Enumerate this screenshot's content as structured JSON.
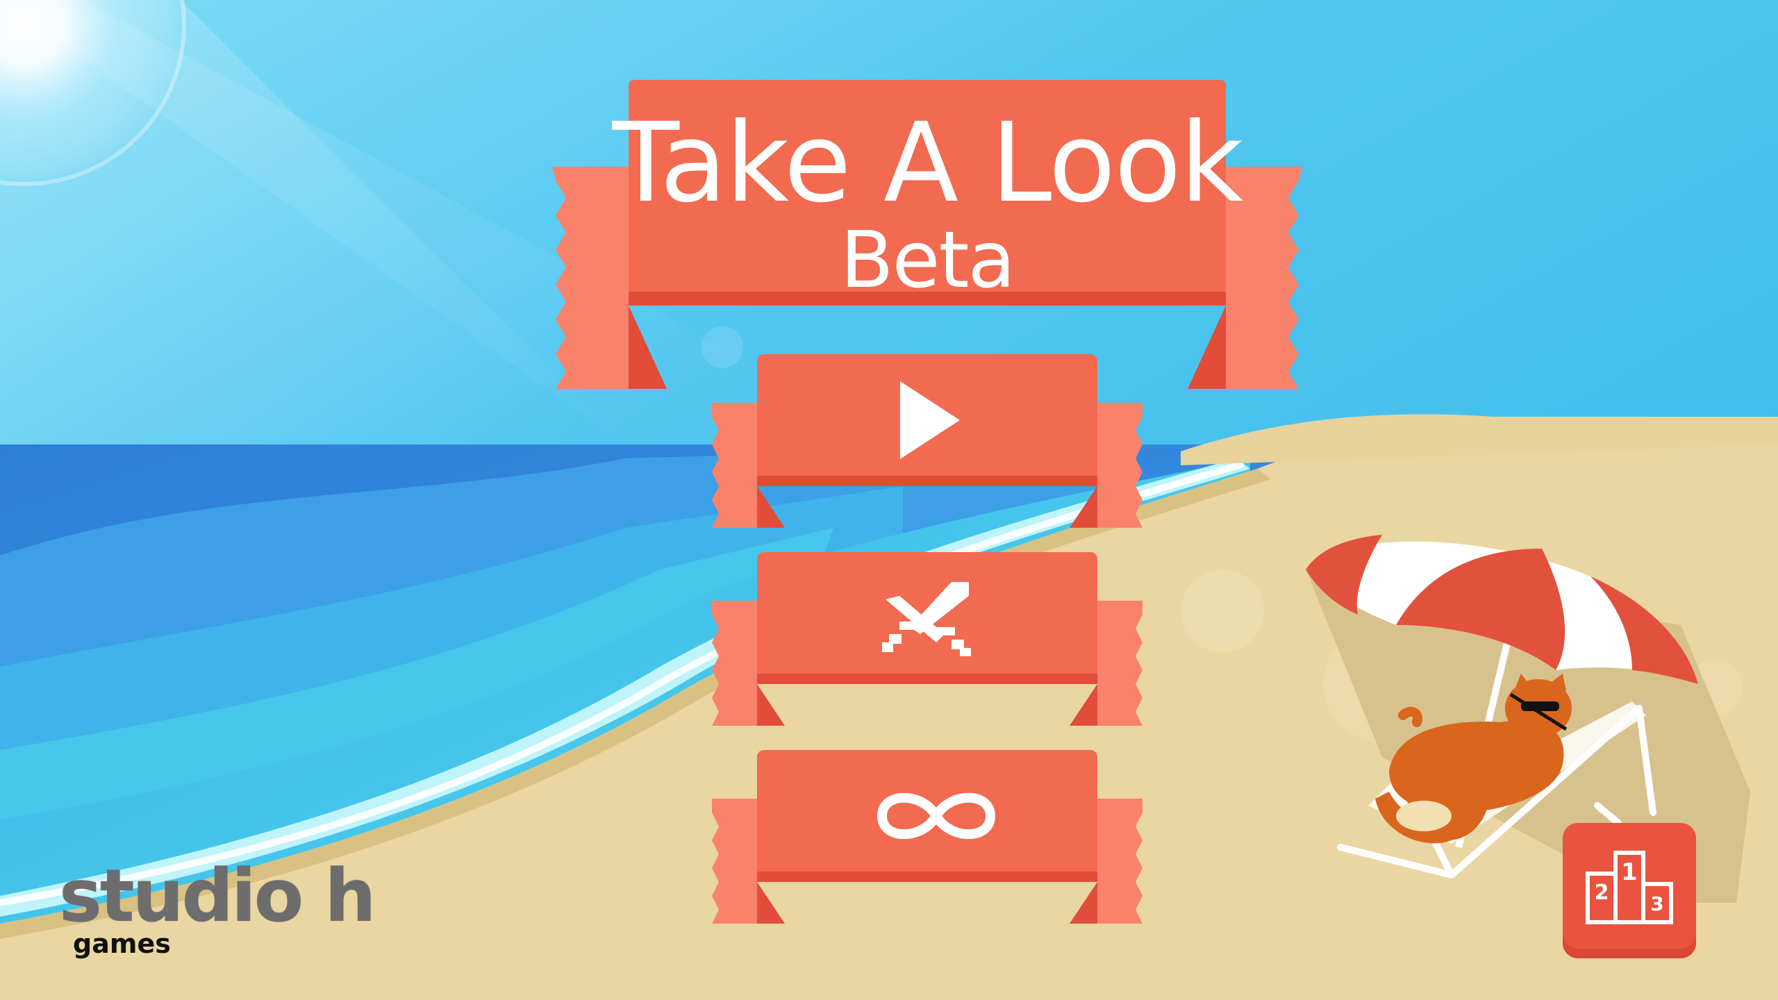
{
  "game": {
    "title_line1": "Take A Look",
    "title_line2": "Beta"
  },
  "menu": {
    "buttons": [
      {
        "id": "play",
        "icon": "play-icon"
      },
      {
        "id": "versus",
        "icon": "crossed-swords-icon"
      },
      {
        "id": "endless",
        "icon": "infinity-icon"
      }
    ],
    "leaderboard": {
      "icon": "podium-icon",
      "ranks": [
        "1",
        "2",
        "3"
      ]
    }
  },
  "branding": {
    "studio": "studio h",
    "sub": "games"
  },
  "colors": {
    "banner_red": "#f26a50",
    "banner_dark": "#e14d38",
    "banner_light": "#f9826a",
    "sky": "#3ab9ea",
    "sand": "#ead6a2",
    "ocean_deep": "#3a8ee0"
  }
}
